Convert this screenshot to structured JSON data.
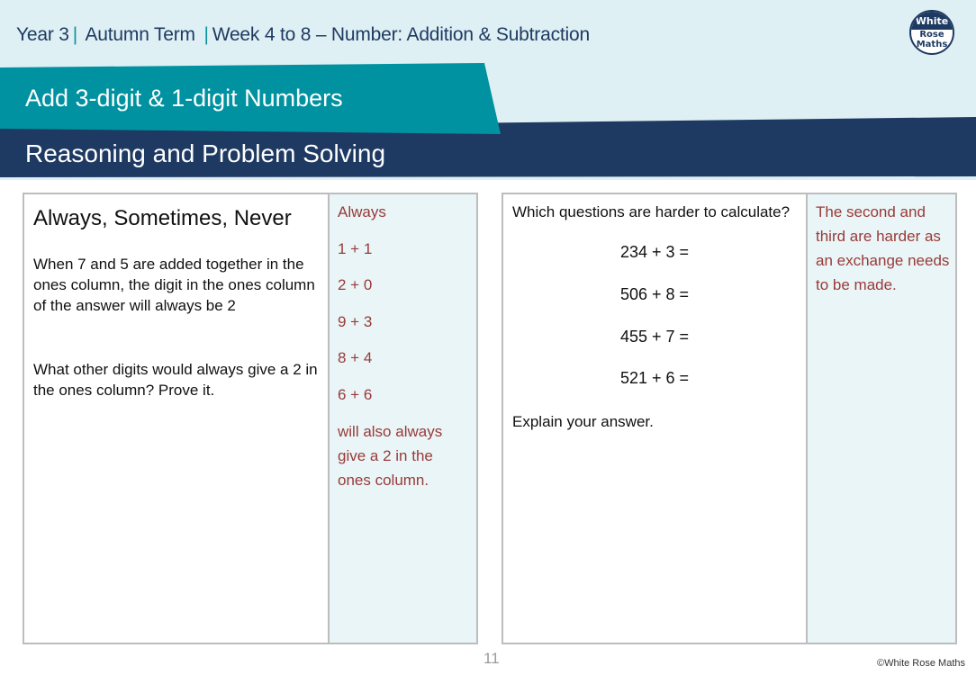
{
  "header": {
    "breadcrumb": {
      "year": "Year 3",
      "term": "Autumn Term",
      "unit": "Week 4 to 8 – Number: Addition & Subtraction"
    },
    "logo": {
      "line1": "White",
      "line2": "Rose",
      "line3": "Maths"
    },
    "lesson_title": "Add 3-digit & 1-digit Numbers",
    "section_title": "Reasoning and Problem Solving"
  },
  "left_panel": {
    "heading": "Always, Sometimes, Never",
    "statement": "When 7 and 5 are added together in the ones column, the digit in the ones column of the answer will always be 2",
    "question": "What other digits would always give a 2 in the ones column? Prove it.",
    "answer": {
      "verdict": "Always",
      "pairs": [
        "1 + 1",
        "2 + 0",
        "9 + 3",
        "8 + 4",
        "6 + 6"
      ],
      "conclusion": "will also always give a 2 in the ones column."
    }
  },
  "right_panel": {
    "question": "Which questions are harder to calculate?",
    "calculations": [
      "234 + 3 =",
      "506 + 8 =",
      "455 + 7 =",
      "521 + 6 ="
    ],
    "prompt": "Explain your answer.",
    "answer": "The second and third are harder as an exchange needs to be made."
  },
  "footer": {
    "page_number": "11",
    "copyright": "©White Rose Maths"
  },
  "colors": {
    "navy": "#1e3a62",
    "teal": "#0092a0",
    "light_bg": "#dff0f4",
    "answer_bg": "#e9f5f6",
    "answer_text": "#9a3a3a"
  }
}
